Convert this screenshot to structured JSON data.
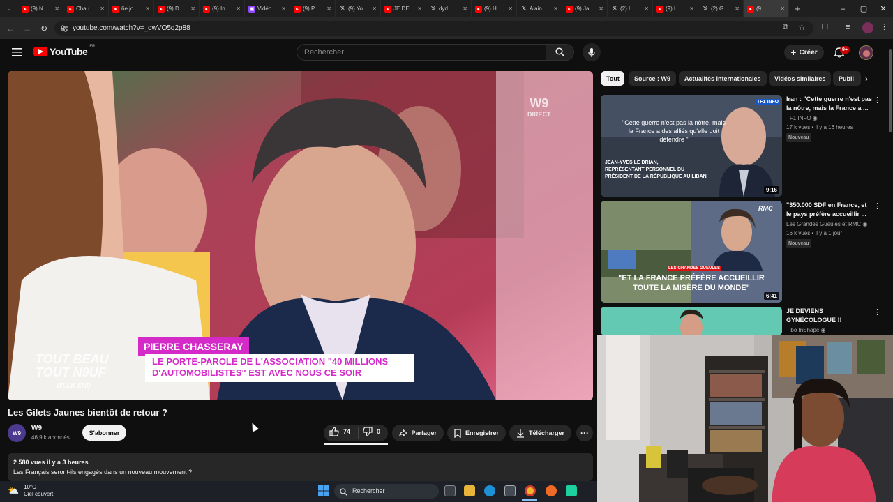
{
  "browser": {
    "tabs": [
      {
        "icon": "youtube-icon",
        "label": "(9) N"
      },
      {
        "icon": "youtube-icon",
        "label": "Chau"
      },
      {
        "icon": "youtube-icon",
        "label": "6e jo"
      },
      {
        "icon": "youtube-icon",
        "label": "(9) D"
      },
      {
        "icon": "youtube-icon",
        "label": "(9) In"
      },
      {
        "icon": "twitch-icon",
        "label": "Vidéo"
      },
      {
        "icon": "youtube-icon",
        "label": "(9) P"
      },
      {
        "icon": "x-icon",
        "label": "(9) Yo"
      },
      {
        "icon": "youtube-icon",
        "label": "JE DE"
      },
      {
        "icon": "x-icon",
        "label": "dyd"
      },
      {
        "icon": "youtube-icon",
        "label": "(9) H"
      },
      {
        "icon": "x-icon",
        "label": "Alain"
      },
      {
        "icon": "youtube-icon",
        "label": "(9) Ja"
      },
      {
        "icon": "x-icon",
        "label": "(2) L"
      },
      {
        "icon": "youtube-icon",
        "label": "(9) L"
      },
      {
        "icon": "x-icon",
        "label": "(2) G"
      },
      {
        "icon": "youtube-icon",
        "label": "(9"
      }
    ],
    "active_tab_index": 16,
    "url": "youtube.com/watch?v=_dwVO5q2p88"
  },
  "yt_header": {
    "logo_text": "YouTube",
    "logo_region": "FR",
    "search_placeholder": "Rechercher",
    "create_label": "Créer",
    "notifications_count": "9+"
  },
  "player": {
    "channel_watermark": "W9",
    "channel_watermark_sub": "DIRECT",
    "show_logo_line1": "TOUT BEAU",
    "show_logo_line2": "TOUT N9UF",
    "show_logo_line3": "WEEK-END",
    "lower_third_name": "PIERRE CHASSERAY",
    "lower_third_line1": "LE PORTE-PAROLE DE L'ASSOCIATION \"40 MILLIONS",
    "lower_third_line2": "D'AUTOMOBILISTES\" EST AVEC NOUS CE SOIR"
  },
  "video": {
    "title": "Les Gilets Jaunes bientôt de retour ?",
    "channel_name": "W9",
    "channel_avatar_text": "W9",
    "subscribers": "46,9 k abonnés",
    "subscribe_label": "S'abonner",
    "likes": "74",
    "dislikes": "0",
    "share_label": "Partager",
    "save_label": "Enregistrer",
    "download_label": "Télécharger",
    "views_and_date": "2 580 vues  il y a 3 heures",
    "description": "Les Français seront-ils engagés dans un nouveau mouvement ?"
  },
  "chips": [
    "Tout",
    "Source : W9",
    "Actualités internationales",
    "Vidéos similaires",
    "Publi"
  ],
  "recommendations": [
    {
      "title": "Iran : \"Cette guerre n'est pas la nôtre, mais la France a ...",
      "channel": "TF1 INFO",
      "meta": "17 k vues • il y a 16 heures",
      "badge": "Nouveau",
      "duration": "9:16",
      "thumb_logo": "TF1 INFO",
      "thumb_quote": "\"Cette guerre n'est pas la nôtre, mais la France a des alliés qu'elle doit défendre \"",
      "thumb_caption1": "JEAN-YVES LE DRIAN,",
      "thumb_caption2": "REPRÉSENTANT PERSONNEL DU",
      "thumb_caption3": "PRÉSIDENT DE LA RÉPUBLIQUE AU LIBAN"
    },
    {
      "title": "\"350.000 SDF en France, et le pays préfère accueillir ...",
      "channel": "Les Grandes Gueules et RMC",
      "meta": "16 k vues • il y a 1 jour",
      "badge": "Nouveau",
      "duration": "6:41",
      "thumb_logo": "RMC",
      "thumb_tag": "LES GRANDES GUEULES",
      "thumb_line1": "\"ET LA FRANCE PRÉFÈRE ACCUEILLIR",
      "thumb_line2": "TOUTE LA MISÈRE DU MONDE\""
    },
    {
      "title": "JE DEVIENS GYNÉCOLOGUE !!",
      "channel": "Tibo InShape"
    }
  ],
  "taskbar": {
    "weather_temp": "10°C",
    "weather_desc": "Ciel couvert",
    "search_label": "Rechercher"
  },
  "colors": {
    "yt_red": "#ff0000",
    "background": "#0f0f0f",
    "chip_bg": "#272727",
    "lower_third_magenta": "#d42ac8"
  }
}
